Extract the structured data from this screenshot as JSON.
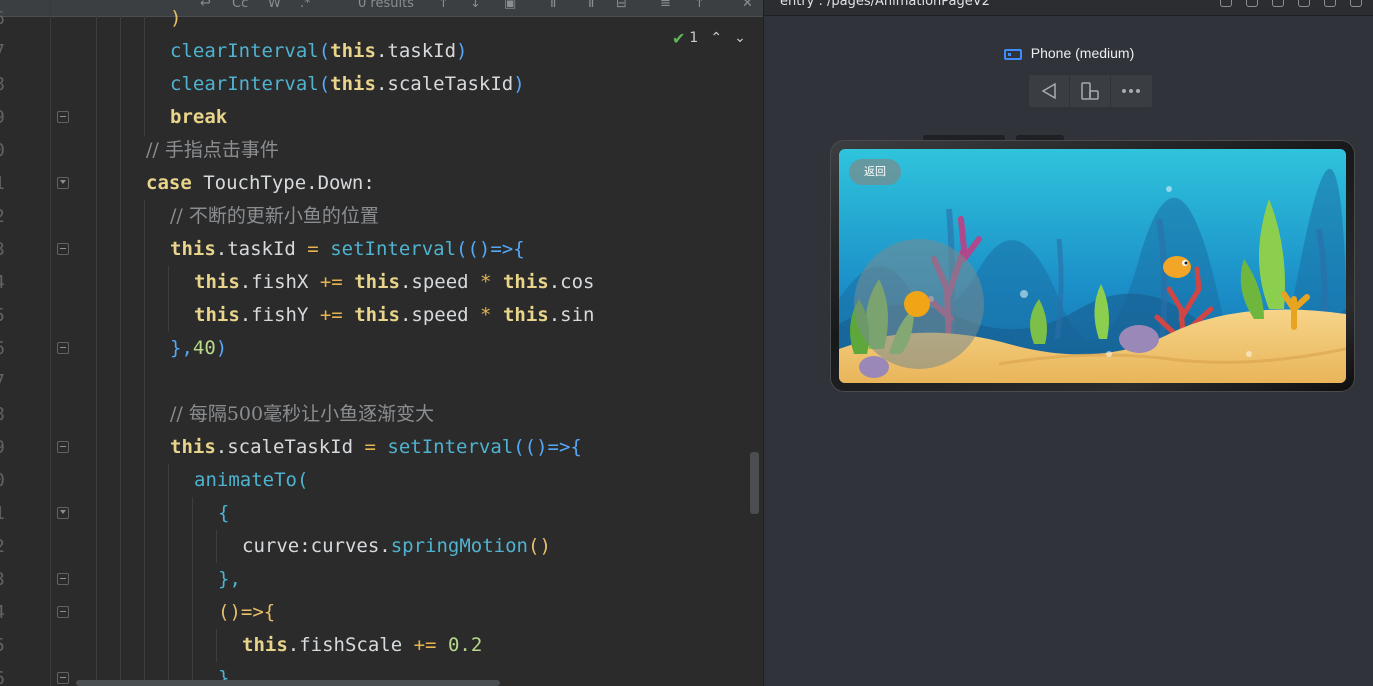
{
  "findbar": {
    "results": "0 results"
  },
  "inspection": {
    "count": "1"
  },
  "gutter_numbers": [
    "6",
    "7",
    "8",
    "9",
    "0",
    "1",
    "2",
    "3",
    "4",
    "5",
    "6",
    "7",
    "8",
    "9",
    "0",
    "1",
    "2",
    "3",
    "4",
    "5",
    "6"
  ],
  "code": {
    "l1": ")",
    "l2_fn": "clearInterval",
    "l2_kw": "this",
    "l2_rest": ".taskId",
    "l3_fn": "clearInterval",
    "l3_kw": "this",
    "l3_rest": ".scaleTaskId",
    "l4": "break",
    "l5": "// 手指点击事件",
    "l6_kw": "case",
    "l6_rest": " TouchType.Down:",
    "l7": "// 不断的更新小鱼的位置",
    "l8_kw": "this",
    "l8_rest": ".taskId ",
    "l8_op": "=",
    "l8_fn": "setInterval",
    "l8_tail": "(()=>{",
    "l9_kw1": "this",
    "l9_a": ".fishX ",
    "l9_op": "+=",
    "l9_kw2": "this",
    "l9_b": ".speed ",
    "l9_op2": "*",
    "l9_kw3": "this",
    "l9_c": ".cos",
    "l10_kw1": "this",
    "l10_a": ".fishY ",
    "l10_op": "+=",
    "l10_kw2": "this",
    "l10_b": ".speed ",
    "l10_op2": "*",
    "l10_kw3": "this",
    "l10_c": ".sin",
    "l11_a": "},",
    "l11_num": "40",
    "l11_b": ")",
    "l12": "",
    "l13": "// 每隔500毫秒让小鱼逐渐变大",
    "l14_kw": "this",
    "l14_rest": ".scaleTaskId ",
    "l14_op": "=",
    "l14_fn": "setInterval",
    "l14_tail": "(()=>{",
    "l15_fn": "animateTo",
    "l15_tail": "(",
    "l16": "{",
    "l17_a": "curve:curves.",
    "l17_fn": "springMotion",
    "l17_tail": "()",
    "l18": "},",
    "l19": "()=>{",
    "l20_kw": "this",
    "l20_a": ".fishScale ",
    "l20_op": "+=",
    "l20_num": "0.2",
    "l21": "}"
  },
  "previewer": {
    "path": "entry : /pages/AnimationPageV2",
    "device": "Phone (medium)",
    "back_icon": "triangle-left-icon",
    "rotate_icon": "rotate-device-icon",
    "more_icon": "more-dots-icon",
    "app_back_button": "返回"
  }
}
